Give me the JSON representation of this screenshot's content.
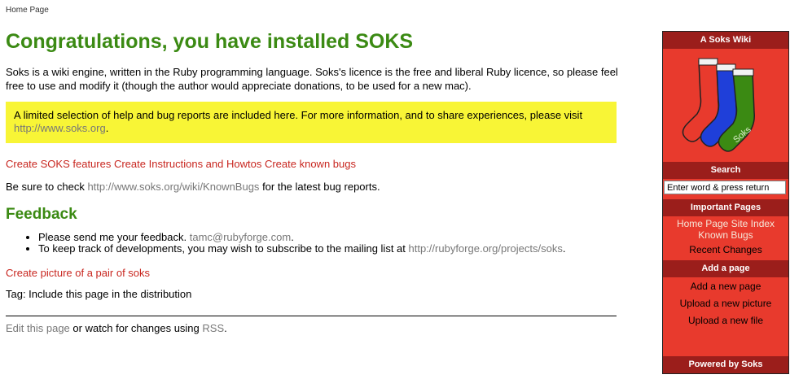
{
  "breadcrumb": "Home Page",
  "title": "Congratulations, you have installed SOKS",
  "intro": "Soks is a wiki engine, written in the Ruby programming language. Soks's licence is the free and liberal Ruby licence, so please feel free to use and modify it (though the author would appreciate donations, to be used for a new mac).",
  "notice": {
    "text": "A limited selection of help and bug reports are included here. For more information, and to share experiences, please visit",
    "link": "http://www.soks.org",
    "suffix": "."
  },
  "feature_links": [
    "Create SOKS features",
    "Create Instructions and Howtos",
    "Create known bugs"
  ],
  "check": {
    "prefix": "Be sure to check",
    "link": "http://www.soks.org/wiki/KnownBugs",
    "suffix": "for the latest bug reports."
  },
  "feedback": {
    "heading": "Feedback",
    "item1_prefix": "Please send me your feedback.",
    "item1_link": "tamc@rubyforge.com",
    "item1_suffix": ".",
    "item2_prefix": "To keep track of developments, you may wish to subscribe to the mailing list at",
    "item2_link": "http://rubyforge.org/projects/soks",
    "item2_suffix": "."
  },
  "create_pair": "Create picture of a pair of soks",
  "tag_line": "Tag: Include this page in the distribution",
  "footer": {
    "edit_link": "Edit this page",
    "middle": "or watch for changes using",
    "rss_link": "RSS",
    "suffix": "."
  },
  "sidebar": {
    "header": "A Soks Wiki",
    "logo_text": "Soks",
    "search_header": "Search",
    "search_value": "Enter word & press return",
    "important_header": "Important Pages",
    "important_links": [
      "Home Page",
      "Site Index",
      "Known Bugs"
    ],
    "recent_changes": "Recent Changes",
    "add_header": "Add a page",
    "add_links": [
      "Add a new page",
      "Upload a new picture",
      "Upload a new file"
    ],
    "powered_by": "Powered by Soks"
  },
  "colors": {
    "heading_green": "#3b8a13",
    "notice_yellow": "#f8f536",
    "link_red": "#c8261f",
    "link_grey": "#777777",
    "sidebar_red": "#e83a2d",
    "sidebar_dark": "#9b1e1b"
  }
}
